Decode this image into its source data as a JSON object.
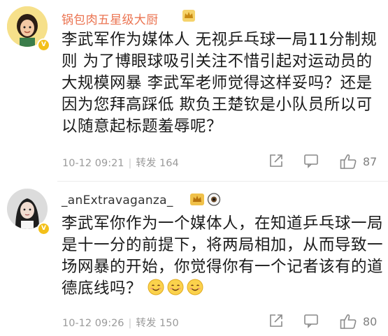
{
  "comments": [
    {
      "username": "锅包肉五星级大厨",
      "text_lines": [
        "李武军作为媒体人 无视乒乓球一局11分制规",
        "则 为了博眼球吸引关注不惜引起对运动员的",
        "大规模网暴 李武军老师觉得这样妥吗？还是",
        "因为您拜高踩低 欺负王楚钦是小队员所以可",
        "以随意起标题羞辱呢？"
      ],
      "timestamp": "10-12 09:21",
      "repost_label": "转发 164",
      "likes": "87",
      "badge_icons": [
        "crown-badge-icon"
      ],
      "avatar_icon": "cartoon-girl-avatar"
    },
    {
      "username": "_anExtravaganza_",
      "text_lines": [
        "李武军你作为一个媒体人，在知道乒乓球一局",
        "是十一分的前提下，将两局相加，从而导致一",
        "场网暴的开始，你觉得你有一个记者该有的道",
        "德底线吗？"
      ],
      "emojis": [
        "smile-emoji",
        "smile-emoji",
        "smile-emoji"
      ],
      "timestamp": "10-12 09:26",
      "repost_label": "转发 150",
      "likes": "80",
      "badge_icons": [
        "crown-badge-icon",
        "eye-badge-icon"
      ],
      "avatar_icon": "photo-avatar"
    }
  ],
  "colors": {
    "username_highlight": "#eb7350",
    "meta_gray": "#9a9a9a",
    "badge_gold": "#f3c01a"
  }
}
